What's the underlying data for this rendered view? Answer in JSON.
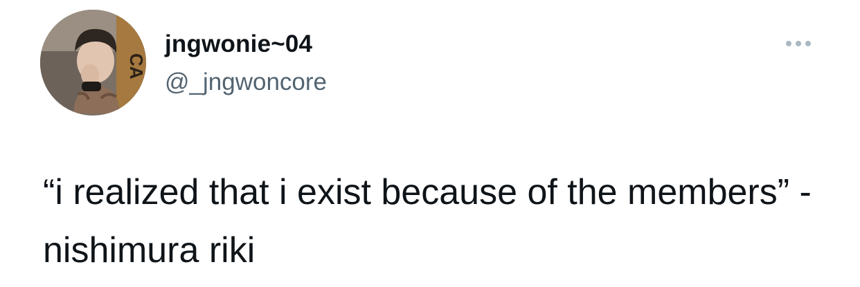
{
  "tweet": {
    "author": {
      "display_name": "jngwonie~04",
      "handle": "@_jngwoncore",
      "avatar_icon": "profile-photo"
    },
    "more_icon": "more-horizontal-icon",
    "text": "“i realized that i exist because of the members” - nishimura riki"
  },
  "colors": {
    "text_primary": "#0f1419",
    "text_secondary": "#536471",
    "more_dots": "#aab8c2",
    "background": "#ffffff"
  }
}
